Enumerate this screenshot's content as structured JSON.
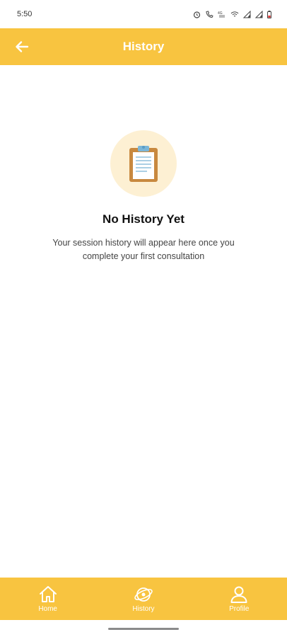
{
  "status_bar": {
    "time": "5:50",
    "icons": [
      "alarm-icon",
      "wifi-calling-icon",
      "data-icon",
      "wifi-icon",
      "signal-icon",
      "signal-icon",
      "battery-icon"
    ]
  },
  "app_bar": {
    "title": "History",
    "back_icon": "arrow-left-icon"
  },
  "empty_state": {
    "icon": "clipboard-icon",
    "title": "No History Yet",
    "description": "Your session history will appear here once you complete your first consultation"
  },
  "bottom_nav": {
    "items": [
      {
        "label": "Home",
        "icon": "home-icon"
      },
      {
        "label": "History",
        "icon": "history-icon",
        "active": true
      },
      {
        "label": "Profile",
        "icon": "profile-icon"
      }
    ]
  },
  "colors": {
    "accent": "#f8c440",
    "icon_circle": "#fdf0d3",
    "clipboard_board": "#c8893f",
    "clipboard_clip": "#7bb6d8"
  }
}
